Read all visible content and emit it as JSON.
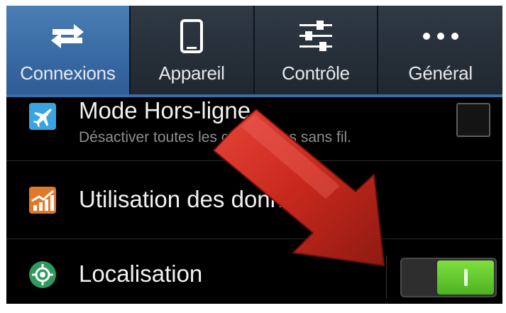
{
  "tabs": [
    {
      "label": "Connexions",
      "icon": "arrows-swap-icon",
      "active": true
    },
    {
      "label": "Appareil",
      "icon": "phone-icon",
      "active": false
    },
    {
      "label": "Contrôle",
      "icon": "sliders-icon",
      "active": false
    },
    {
      "label": "Général",
      "icon": "more-dots-icon",
      "active": false
    }
  ],
  "settings": {
    "airplane_mode": {
      "title": "Mode Hors-ligne",
      "subtitle": "Désactiver toutes les connexions sans fil.",
      "checked": false,
      "icon": "airplane-icon",
      "icon_color": "#3aa3e0"
    },
    "data_usage": {
      "title": "Utilisation des données",
      "icon": "data-usage-chart-icon",
      "icon_color": "#e07a2a"
    },
    "location": {
      "title": "Localisation",
      "enabled": true,
      "icon": "location-target-icon",
      "icon_color": "#2e9a5c"
    }
  },
  "overlay": {
    "icon": "red-arrow-annotation",
    "color": "#c8281c"
  },
  "colors": {
    "active_tab": "#3a6ea8",
    "switch_on": "#5cc92a"
  }
}
